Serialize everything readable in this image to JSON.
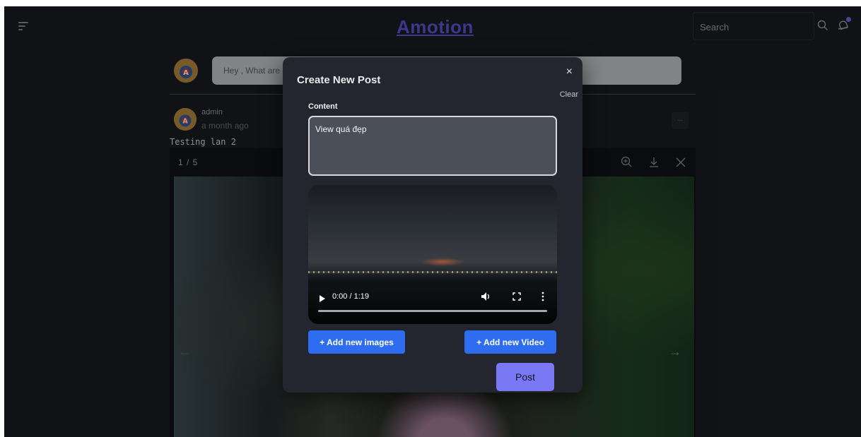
{
  "header": {
    "brand": "Amotion",
    "search_placeholder": "Search"
  },
  "composer": {
    "placeholder": "Hey , What are"
  },
  "post": {
    "author": "admin",
    "time": "a month ago",
    "text": "Testing lan 2",
    "more_label": "..."
  },
  "viewer": {
    "counter": "1 / 5",
    "prev_icon": "arrow-left",
    "next_icon": "arrow-right",
    "next_label": "→",
    "prev_label": "←"
  },
  "modal": {
    "title": "Create New Post",
    "close_label": "×",
    "clear_label": "Clear",
    "content_label": "Content",
    "content_value": "View quá đẹp",
    "video": {
      "time": "0:00 / 1:19"
    },
    "add_images_label": "+ Add new images",
    "add_video_label": "+ Add new Video",
    "post_label": "Post"
  },
  "colors": {
    "brand": "#5b55d6",
    "button_blue": "#2e6df0",
    "post_button": "#7b78f6",
    "notification_dot": "#6f6cf0"
  }
}
